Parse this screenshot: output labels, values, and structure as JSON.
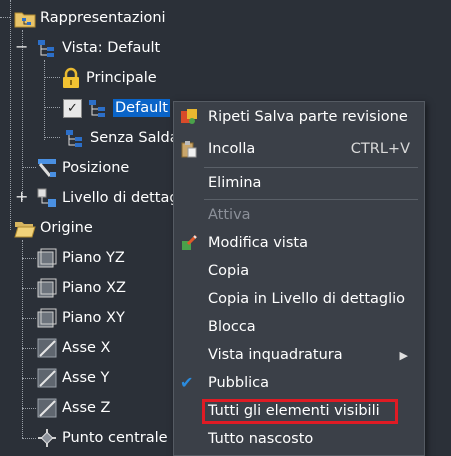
{
  "tree": {
    "items": [
      {
        "label": "Rappresentazioni",
        "icon": "folder-hierarchy-icon"
      },
      {
        "label": "Vista: Default",
        "icon": "hierarchy-icon"
      },
      {
        "label": "Principale",
        "icon": "lock-icon"
      },
      {
        "label": "Default",
        "icon": "hierarchy-icon",
        "checked": true,
        "selected": true
      },
      {
        "label": "Senza Saldat",
        "icon": "hierarchy-icon"
      },
      {
        "label": "Posizione",
        "icon": "position-icon"
      },
      {
        "label": "Livello di dettag",
        "icon": "level-of-detail-icon"
      },
      {
        "label": "Origine",
        "icon": "folder-open-icon"
      },
      {
        "label": "Piano YZ",
        "icon": "plane-icon"
      },
      {
        "label": "Piano XZ",
        "icon": "plane-icon"
      },
      {
        "label": "Piano XY",
        "icon": "plane-icon"
      },
      {
        "label": "Asse X",
        "icon": "axis-icon"
      },
      {
        "label": "Asse Y",
        "icon": "axis-icon"
      },
      {
        "label": "Asse Z",
        "icon": "axis-icon"
      },
      {
        "label": "Punto centrale",
        "icon": "center-point-icon"
      }
    ],
    "expanders": {
      "collapse": "−",
      "expand": "+"
    },
    "check_glyph": "✓"
  },
  "context_menu": {
    "items": [
      {
        "label": "Ripeti Salva parte revisione",
        "icon": "revision-icon",
        "shortcut": ""
      },
      {
        "label": "Incolla",
        "icon": "paste-icon",
        "shortcut": "CTRL+V"
      },
      {
        "label": "Elimina",
        "icon": "",
        "shortcut": ""
      },
      {
        "label": "Attiva",
        "icon": "",
        "shortcut": "",
        "disabled": true
      },
      {
        "label": "Modifica vista",
        "icon": "edit-view-icon",
        "shortcut": ""
      },
      {
        "label": "Copia",
        "icon": "",
        "shortcut": ""
      },
      {
        "label": "Copia in Livello di dettaglio",
        "icon": "",
        "shortcut": ""
      },
      {
        "label": "Blocca",
        "icon": "",
        "shortcut": ""
      },
      {
        "label": "Vista inquadratura",
        "icon": "",
        "shortcut": "",
        "submenu": true
      },
      {
        "label": "Pubblica",
        "icon": "checkmark-icon",
        "shortcut": ""
      },
      {
        "label": "Tutti gli elementi visibili",
        "icon": "",
        "shortcut": "",
        "highlighted": true
      },
      {
        "label": "Tutto nascosto",
        "icon": "",
        "shortcut": ""
      }
    ],
    "submenu_arrow": "▶",
    "checkmark": "✔"
  },
  "colors": {
    "background": "#2b3038",
    "menu_background": "#3b4048",
    "selection": "#0a64c8",
    "highlight_border": "#e01b24",
    "check_blue": "#2a8bde"
  }
}
